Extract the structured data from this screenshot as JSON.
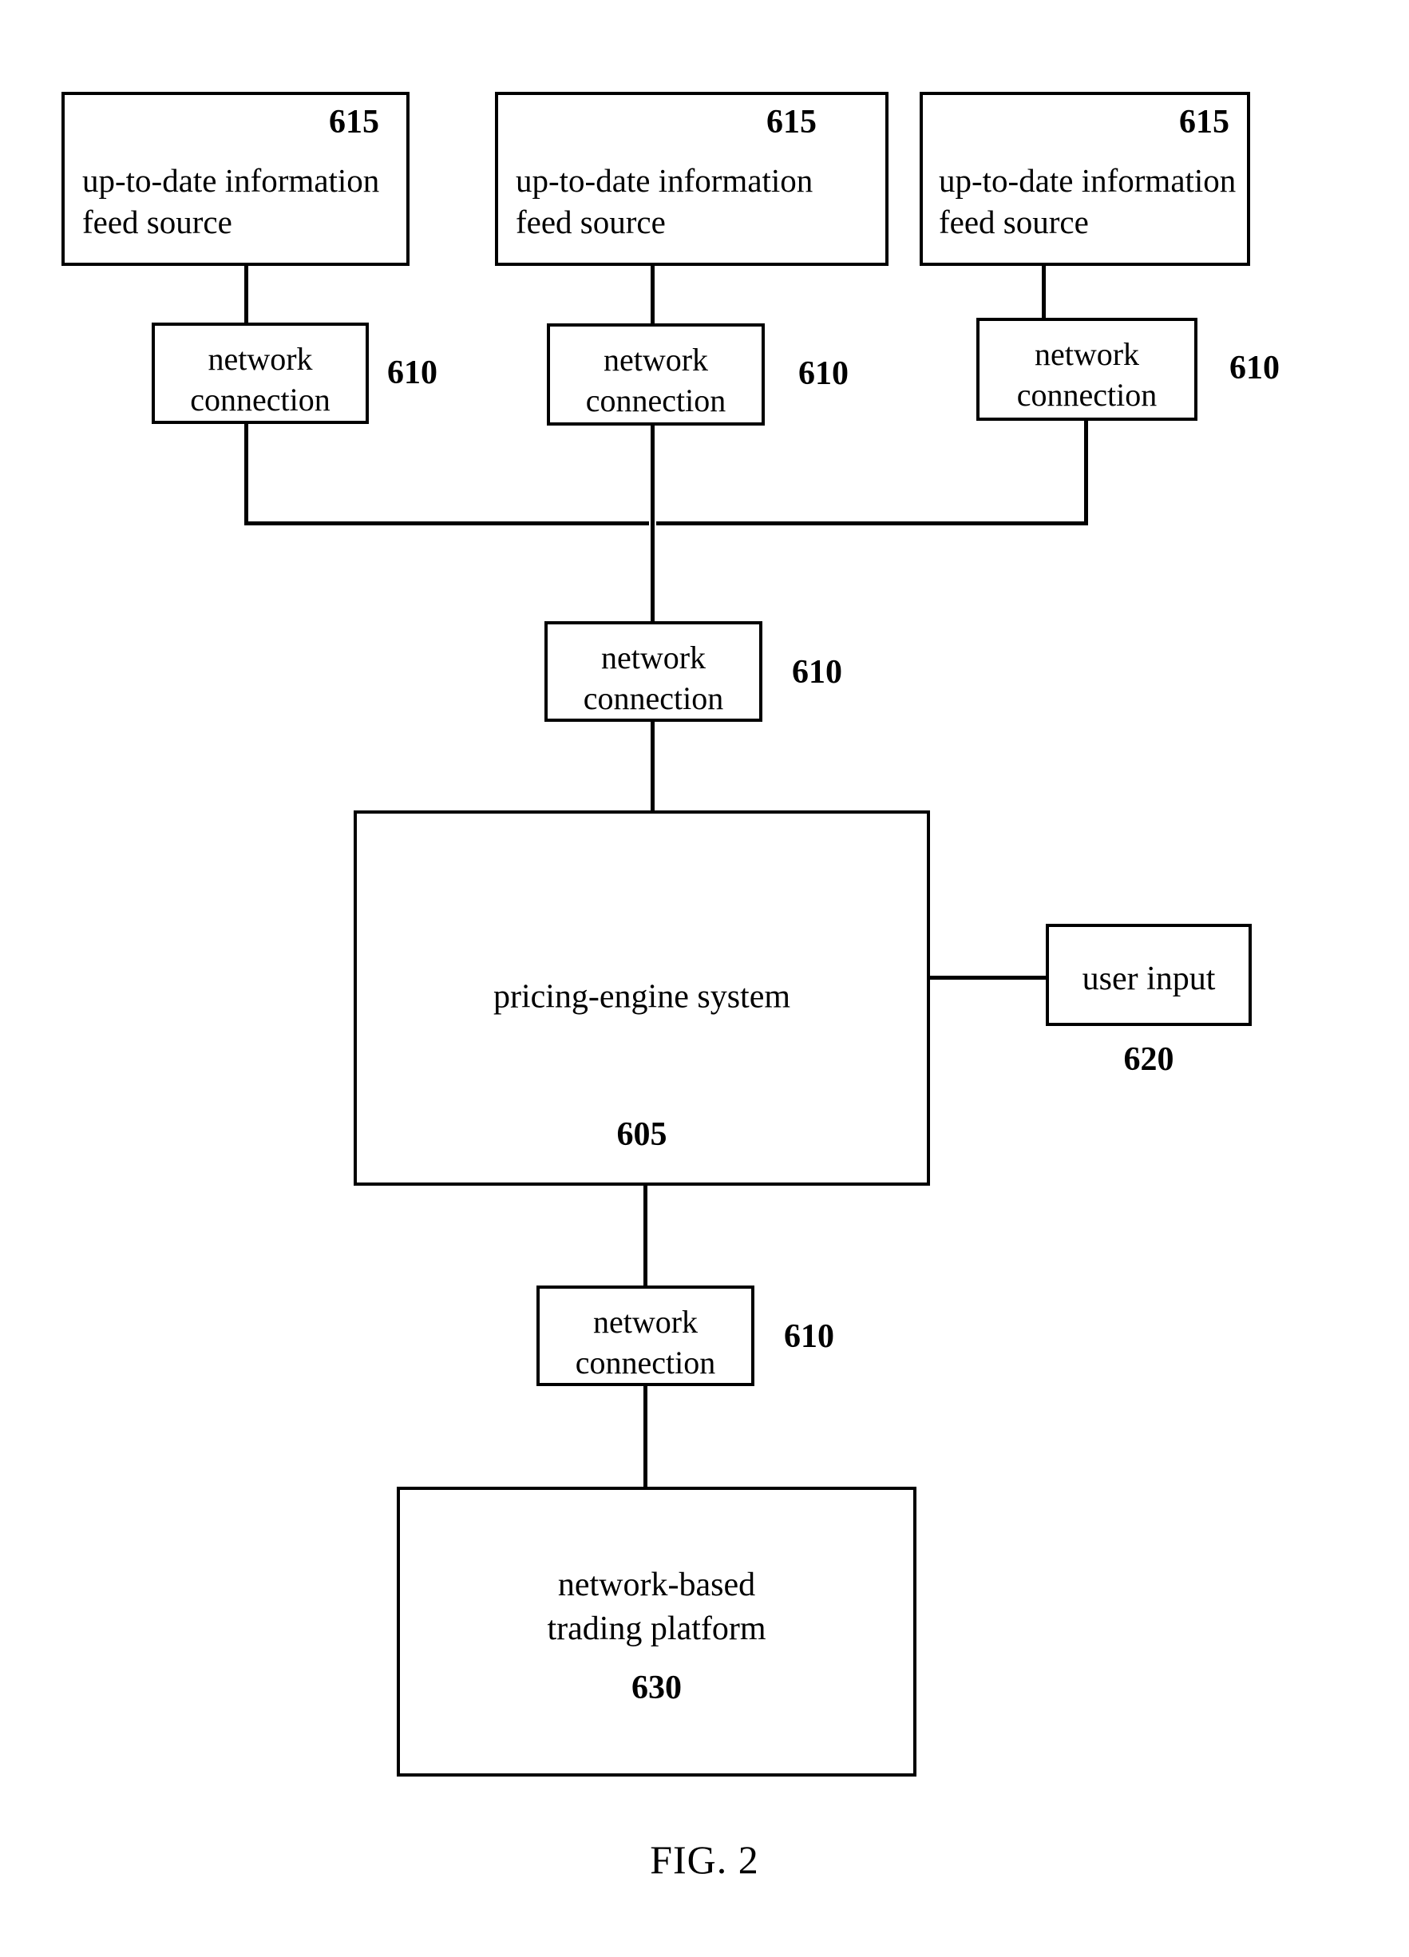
{
  "figure": {
    "caption": "FIG. 2"
  },
  "feed_sources": [
    {
      "ref": "615",
      "line1": "up-to-date information",
      "line2": "feed source"
    },
    {
      "ref": "615",
      "line1": "up-to-date information",
      "line2": "feed source"
    },
    {
      "ref": "615",
      "line1": "up-to-date information",
      "line2": "feed source"
    }
  ],
  "network_connections": [
    {
      "ref": "610",
      "line1": "network",
      "line2": "connection"
    },
    {
      "ref": "610",
      "line1": "network",
      "line2": "connection"
    },
    {
      "ref": "610",
      "line1": "network",
      "line2": "connection"
    },
    {
      "ref": "610",
      "line1": "network",
      "line2": "connection"
    },
    {
      "ref": "610",
      "line1": "network",
      "line2": "connection"
    }
  ],
  "pricing_engine": {
    "title": "pricing-engine system",
    "ref": "605"
  },
  "user_input": {
    "title": "user input",
    "ref": "620"
  },
  "trading_platform": {
    "line1": "network-based",
    "line2": "trading platform",
    "ref": "630"
  },
  "colors": {
    "stroke": "#000000",
    "background": "#ffffff"
  }
}
